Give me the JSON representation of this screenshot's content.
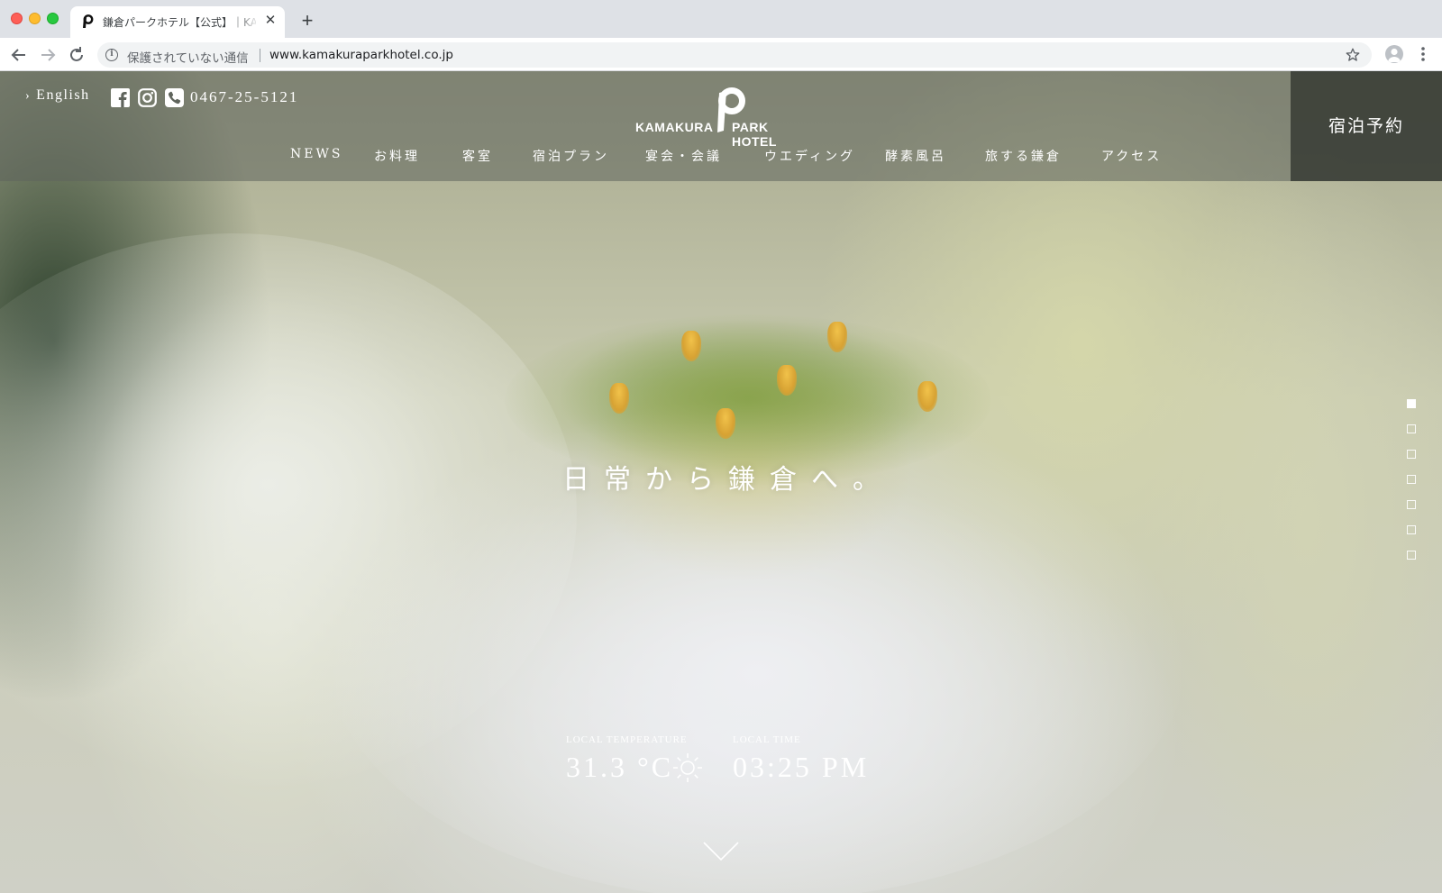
{
  "browser": {
    "tab_title": "鎌倉パークホテル【公式】｜KAMAKURA PARK HOTEL",
    "new_tab": "+",
    "close": "✕",
    "security_label": "保護されていない通信",
    "url": "www.kamakuraparkhotel.co.jp"
  },
  "header": {
    "language_link": "English",
    "phone": "0467-25-5121",
    "logo_left": "KAMAKURA",
    "logo_right": "PARK HOTEL",
    "reserve_button": "宿泊予約",
    "nav": [
      {
        "label": "NEWS"
      },
      {
        "label": "お料理"
      },
      {
        "label": "客室"
      },
      {
        "label": "宿泊プラン"
      },
      {
        "label": "宴会・会議"
      },
      {
        "label": "ウエディング"
      },
      {
        "label": "酵素風呂"
      },
      {
        "label": "旅する鎌倉"
      },
      {
        "label": "アクセス"
      }
    ]
  },
  "hero": {
    "catchphrase": "日常から鎌倉へ。",
    "slides_total": 7,
    "active_slide": 1
  },
  "weather": {
    "temperature_label": "LOCAL TEMPERATURE",
    "temperature_value": "31.3 °C",
    "weather_icon": "sun-icon",
    "time_label": "LOCAL TIME",
    "time_value": "03:25 PM"
  },
  "colors": {
    "header_overlay": "#5f645c",
    "reserve_bg": "#2a2e28",
    "text": "#ffffff"
  }
}
